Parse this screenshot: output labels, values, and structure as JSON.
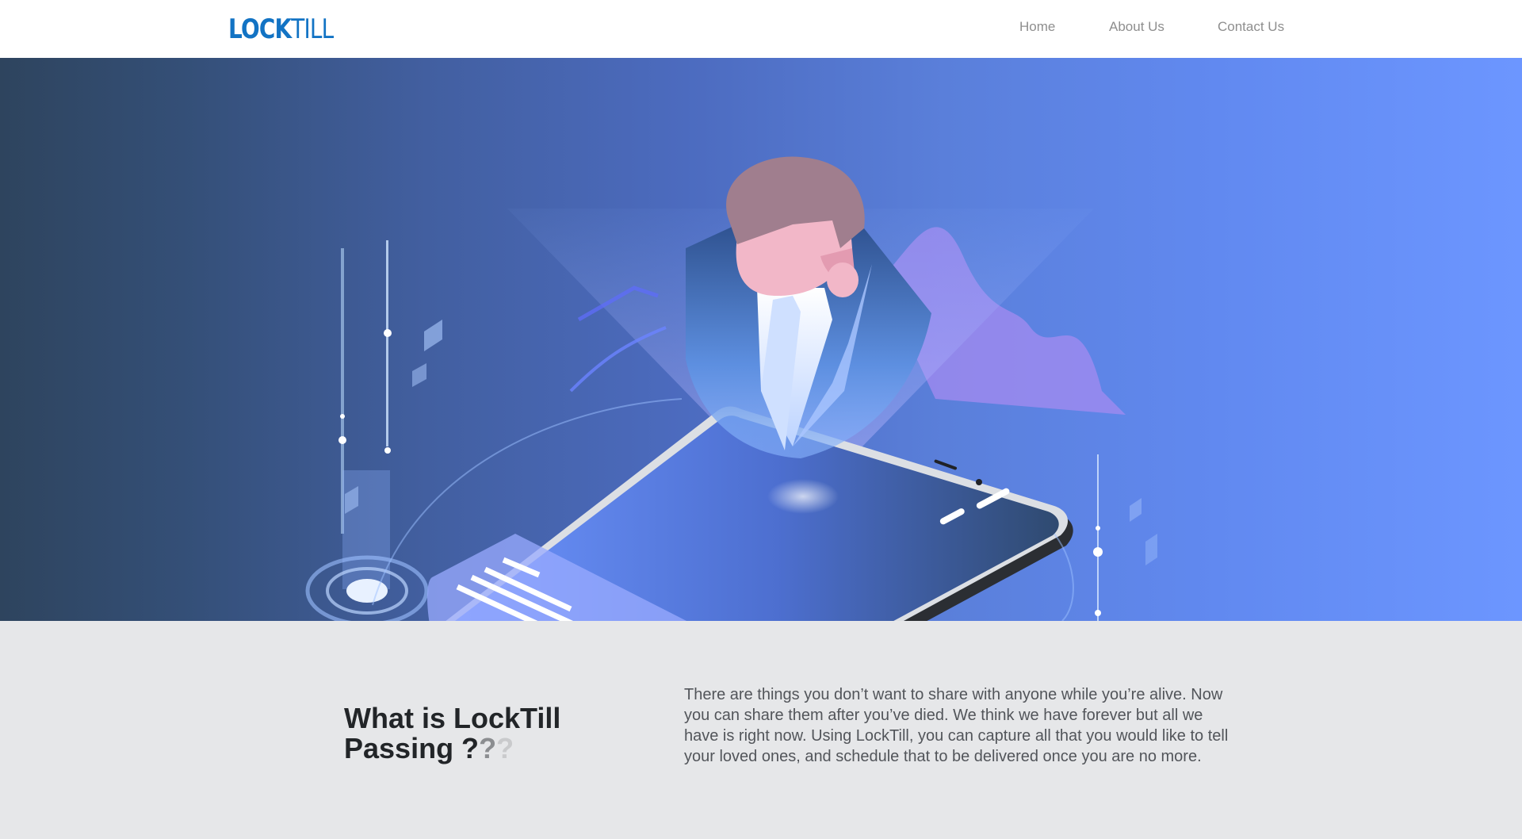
{
  "header": {
    "logo": {
      "part1": "LOCK",
      "part2": "TILL"
    },
    "nav": [
      {
        "label": "Home"
      },
      {
        "label": "About Us"
      },
      {
        "label": "Contact Us"
      }
    ]
  },
  "hero": {
    "illustration": "isometric-person-hologram-over-smartphone"
  },
  "about": {
    "title_line1": "What is LockTill",
    "title_line2": "Passing ?",
    "title_q1": "?",
    "title_q2": "?",
    "body": "There are things you don’t want to share with anyone while you’re alive. Now you can share them after you’ve died. We think we have forever but all we have is right now. Using LockTill, you can capture all that you would like to tell your loved ones, and schedule that to be delivered once you are no more."
  },
  "colors": {
    "brand": "#1273c4",
    "nav_text": "#8e8e8e",
    "hero_left": "#2e445e",
    "hero_right": "#6c96ff",
    "section_bg": "#e6e7e9",
    "heading": "#222528",
    "body_text": "#52555a"
  }
}
